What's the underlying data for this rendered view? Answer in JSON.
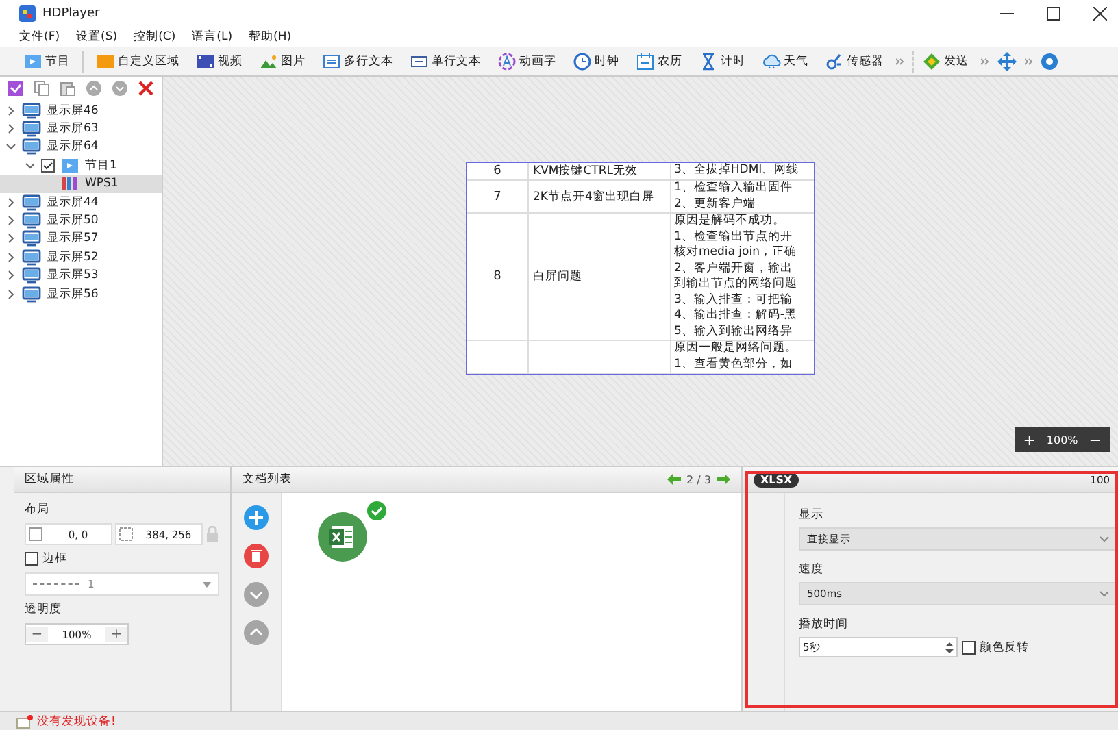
{
  "window": {
    "title": "HDPlayer"
  },
  "menu": [
    "文件(F)",
    "设置(S)",
    "控制(C)",
    "语言(L)",
    "帮助(H)"
  ],
  "toolbar": [
    {
      "label": "节目",
      "kind": "program"
    },
    {
      "label": "自定义区域",
      "kind": "area"
    },
    {
      "label": "视频",
      "kind": "video"
    },
    {
      "label": "图片",
      "kind": "picture"
    },
    {
      "label": "多行文本",
      "kind": "multitext"
    },
    {
      "label": "单行文本",
      "kind": "singletext"
    },
    {
      "label": "动画字",
      "kind": "animtext"
    },
    {
      "label": "时钟",
      "kind": "clock"
    },
    {
      "label": "农历",
      "kind": "calendar"
    },
    {
      "label": "计时",
      "kind": "timer"
    },
    {
      "label": "天气",
      "kind": "weather"
    },
    {
      "label": "传感器",
      "kind": "sensor"
    },
    {
      "label": "发送",
      "kind": "send"
    }
  ],
  "tree": [
    {
      "label": "显示屏46",
      "expanded": false,
      "selected": false,
      "kind": "screen"
    },
    {
      "label": "显示屏63",
      "expanded": false,
      "selected": false,
      "kind": "screen"
    },
    {
      "label": "显示屏64",
      "expanded": true,
      "selected": false,
      "kind": "screen",
      "children": [
        {
          "label": "节目1",
          "expanded": true,
          "selected": false,
          "checked": true,
          "kind": "program",
          "children": [
            {
              "label": "WPS1",
              "selected": true,
              "kind": "doc"
            }
          ]
        }
      ]
    },
    {
      "label": "显示屏44",
      "expanded": false,
      "selected": false,
      "kind": "screen"
    },
    {
      "label": "显示屏50",
      "expanded": false,
      "selected": false,
      "kind": "screen"
    },
    {
      "label": "显示屏57",
      "expanded": false,
      "selected": false,
      "kind": "screen"
    },
    {
      "label": "显示屏52",
      "expanded": false,
      "selected": false,
      "kind": "screen"
    },
    {
      "label": "显示屏53",
      "expanded": false,
      "selected": false,
      "kind": "screen"
    },
    {
      "label": "显示屏56",
      "expanded": false,
      "selected": false,
      "kind": "screen"
    }
  ],
  "preview_table": {
    "rows": [
      {
        "column_1": "6",
        "column_2": "KVM按键CTRL无效",
        "column_3": [
          "3、全拔掉HDMI、网线"
        ]
      },
      {
        "column_1": "7",
        "column_2": "2K节点开4窗出现白屏",
        "column_3": [
          "1、检查输入输出固件",
          "2、更新客户端"
        ]
      },
      {
        "column_1": "8",
        "column_2": "白屏问题",
        "column_3": [
          "原因是解码不成功。",
          "1、检查输出节点的开",
          "核对media join，正确",
          "2、客户端开窗，输出",
          "到输出节点的网络问题",
          "3、输入排查：可把输",
          "4、输出排查：解码-黑",
          "5、输入到输出网络异"
        ]
      },
      {
        "column_1": "",
        "column_2": "",
        "column_3": [
          "原因一般是网络问题。",
          "1、查看黄色部分，如"
        ]
      }
    ]
  },
  "zoom": {
    "plus": "+",
    "value": "100%",
    "minus": "−"
  },
  "area_properties": {
    "title": "区域属性",
    "layout_label": "布局",
    "position": "0, 0",
    "size": "384, 256",
    "border": {
      "label": "边框",
      "checked": false
    },
    "border_style": "1",
    "opacity_label": "透明度",
    "opacity": "100%",
    "decrease": "−",
    "increase": "+"
  },
  "document_list": {
    "title": "文档列表",
    "pager": "2 / 3",
    "files": [
      {
        "kind": "excel",
        "selected": true
      }
    ]
  },
  "xlsx_panel": {
    "badge": "XLSX",
    "zoom": "100",
    "display_label": "显示",
    "display": "直接显示",
    "speed_label": "速度",
    "speed": "500ms",
    "duration_label": "播放时间",
    "duration": "5秒",
    "invert": {
      "label": "颜色反转",
      "checked": false
    }
  },
  "status_bar": {
    "message": "没有发现设备!"
  }
}
